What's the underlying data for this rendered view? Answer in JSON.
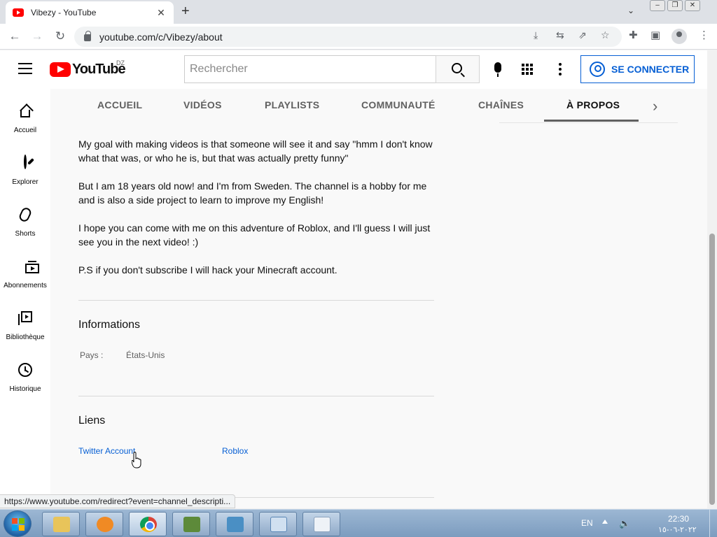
{
  "browser": {
    "tab_title": "Vibezy - YouTube",
    "tab_close": "✕",
    "new_tab": "+",
    "url": "youtube.com/c/Vibezy/about",
    "status_url": "https://www.youtube.com/redirect?event=channel_descripti..."
  },
  "header": {
    "logo_text": "YouTube",
    "country_code": "DZ",
    "search_placeholder": "Rechercher",
    "signin_label": "SE CONNECTER"
  },
  "guide": {
    "items": [
      {
        "label": "Accueil",
        "icon": "home-icon"
      },
      {
        "label": "Explorer",
        "icon": "compass-icon"
      },
      {
        "label": "Shorts",
        "icon": "shorts-icon"
      },
      {
        "label": "Abonnements",
        "icon": "subscriptions-icon"
      },
      {
        "label": "Bibliothèque",
        "icon": "library-icon"
      },
      {
        "label": "Historique",
        "icon": "history-icon"
      }
    ]
  },
  "channel_tabs": {
    "items": [
      "ACCUEIL",
      "VIDÉOS",
      "PLAYLISTS",
      "COMMUNAUTÉ",
      "CHAÎNES",
      "À PROPOS"
    ],
    "active": "À PROPOS"
  },
  "about": {
    "description": [
      "My goal with making videos is that someone will see it and say \"hmm I don't know what that was, or who he is, but that was actually pretty funny\"",
      "But I am 18 years old now! and I'm from Sweden. The channel is a hobby for me and is also a side project to learn to improve my English!",
      "I hope you can come with me on this adventure of Roblox, and I'll guess I will just see you in the next video! :)",
      "P.S if you don't subscribe I will hack your Minecraft account."
    ],
    "info_title": "Informations",
    "country_label": "Pays :",
    "country_value": "États-Unis",
    "links_title": "Liens",
    "links": [
      "Twitter Account",
      "Roblox"
    ]
  },
  "taskbar": {
    "language": "EN",
    "time": "22:30",
    "date": "٢٠٢٢-٠٦-١٥"
  },
  "colors": {
    "youtube_red": "#ff0000",
    "link_blue": "#065fd4"
  }
}
